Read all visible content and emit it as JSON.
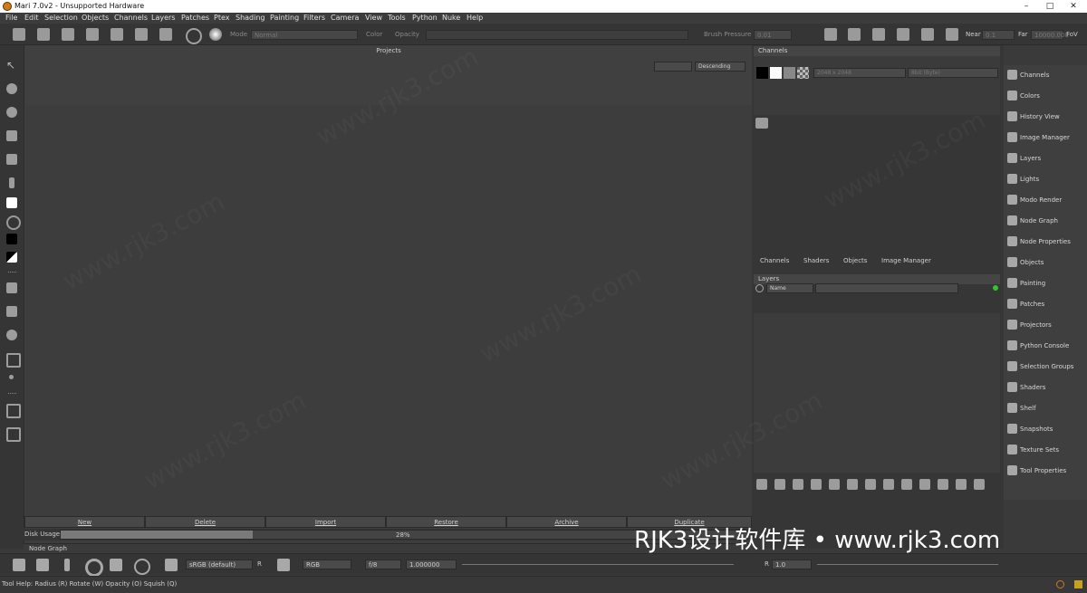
{
  "window": {
    "title": "Mari 7.0v2 - Unsupported Hardware",
    "controls": [
      "–",
      "□",
      "✕"
    ]
  },
  "menu": [
    "File",
    "Edit",
    "Selection",
    "Objects",
    "Channels",
    "Layers",
    "Patches",
    "Ptex",
    "Shading",
    "Painting",
    "Filters",
    "Camera",
    "View",
    "Tools",
    "Python",
    "Nuke",
    "Help"
  ],
  "toolbar": {
    "mode_label": "Mode",
    "mode_value": "Normal",
    "color_label": "Color",
    "opacity_label": "Opacity",
    "brush_pressure_label": "Brush Pressure",
    "brush_pressure_value": "0.01",
    "near_label": "Near",
    "near_value": "0.1",
    "far_label": "Far",
    "far_value": "10000.000",
    "fov_label": "FoV"
  },
  "projects": {
    "title": "Projects",
    "sort_value": "Descending",
    "buttons": [
      "New",
      "Delete",
      "Import",
      "Restore",
      "Archive",
      "Duplicate"
    ],
    "disk_usage_label": "Disk Usage",
    "disk_usage_percent": "28%",
    "disk_usage_fraction": 0.28
  },
  "node_graph_tab": "Node Graph",
  "channels_panel": {
    "title": "Channels",
    "size_value": "2048 x 2048",
    "depth_value": "8bit (Byte)",
    "swatch_colors": [
      "#000000",
      "#ffffff",
      "#888888",
      "checker"
    ]
  },
  "panel_tabs": [
    "Channels",
    "Shaders",
    "Objects",
    "Image Manager"
  ],
  "layers_panel": {
    "title": "Layers",
    "filter_value": "Name"
  },
  "sidebar": [
    {
      "label": "Channels",
      "icon": "channels-icon"
    },
    {
      "label": "Colors",
      "icon": "colors-icon"
    },
    {
      "label": "History View",
      "icon": "history-icon"
    },
    {
      "label": "Image Manager",
      "icon": "image-manager-icon"
    },
    {
      "label": "Layers",
      "icon": "layers-icon"
    },
    {
      "label": "Lights",
      "icon": "lights-icon"
    },
    {
      "label": "Modo Render",
      "icon": "modo-render-icon"
    },
    {
      "label": "Node Graph",
      "icon": "node-graph-icon"
    },
    {
      "label": "Node Properties",
      "icon": "node-properties-icon"
    },
    {
      "label": "Objects",
      "icon": "objects-icon"
    },
    {
      "label": "Painting",
      "icon": "painting-icon"
    },
    {
      "label": "Patches",
      "icon": "patches-icon"
    },
    {
      "label": "Projectors",
      "icon": "projectors-icon"
    },
    {
      "label": "Python Console",
      "icon": "python-console-icon"
    },
    {
      "label": "Selection Groups",
      "icon": "selection-groups-icon"
    },
    {
      "label": "Shaders",
      "icon": "shaders-icon"
    },
    {
      "label": "Shelf",
      "icon": "shelf-icon"
    },
    {
      "label": "Snapshots",
      "icon": "snapshots-icon"
    },
    {
      "label": "Texture Sets",
      "icon": "texture-sets-icon"
    },
    {
      "label": "Tool Properties",
      "icon": "tool-properties-icon"
    }
  ],
  "bottombar": {
    "colorspace_value": "sRGB (default)",
    "r_label": "R",
    "channel_value": "RGB",
    "fstop_value": "f/8",
    "exposure_value": "1.000000",
    "r2_label": "R",
    "gain_value": "1.0"
  },
  "statusbar": {
    "text": "Tool Help:   Radius (R)   Rotate (W)   Opacity (O)   Squish (Q)"
  },
  "watermark": {
    "overlay": "RJK3设计软件库 • www.rjk3.com",
    "tile": "www.rjk3.com"
  }
}
